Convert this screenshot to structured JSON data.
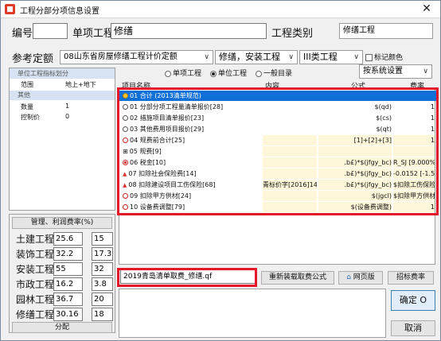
{
  "window": {
    "title": "工程分部分项信息设置",
    "close_glyph": "✕"
  },
  "header": {
    "code_label": "编号",
    "code_value": "",
    "project_label": "单项工程",
    "project_value": "修缮",
    "category_label": "工程类别",
    "category_value": "修缮工程"
  },
  "quota": {
    "label": "参考定额",
    "value": "08山东省房屋修缮工程计价定额",
    "type_value": "修缮，安装工程",
    "class_value": "III类工程",
    "mark_color_label": "标记颜色"
  },
  "radios": [
    {
      "label": "单项工程",
      "selected": false
    },
    {
      "label": "单位工程",
      "selected": true
    },
    {
      "label": "一般目录",
      "selected": false
    }
  ],
  "settings_dropdown": "按系统设置",
  "props": {
    "group1": "单位工程指标划分",
    "scope_label": "范围",
    "scope_value": "地上+地下",
    "group2": "其他",
    "qty_label": "数量",
    "qty_value": "1",
    "ctrl_label": "控制价",
    "ctrl_value": "0"
  },
  "table": {
    "headers": [
      "项目名称",
      "内容",
      "公式",
      "费率"
    ],
    "rows": [
      {
        "name": "01 合计 (2013清单规范)",
        "content": "",
        "formula": "",
        "rate": "",
        "node": "first"
      },
      {
        "name": "01 分部分项工程量清单报价[28]",
        "content": "",
        "formula": "$(qd)",
        "rate": "1",
        "node": "open"
      },
      {
        "name": "02 措施项目清单报价[23]",
        "content": "",
        "formula": "$(cs)",
        "rate": "1",
        "node": "open"
      },
      {
        "name": "03 其他费用项目报价[29]",
        "content": "",
        "formula": "$(qt)",
        "rate": "1",
        "node": "open"
      },
      {
        "name": "04 规费前合计[25]",
        "content": "",
        "formula": "[1]+[2]+[3]",
        "rate": "1",
        "node": "red"
      },
      {
        "name": "05 规费[9]",
        "content": "",
        "formula": "",
        "rate": "",
        "node": "tree"
      },
      {
        "name": "06 税金[10]",
        "content": "",
        "formula": ".b£)*$(jfgy_bc)",
        "rate": "R_SJ [9.000%]",
        "node": "redfill"
      },
      {
        "name": "07 扣除社会保险费[14]",
        "content": "",
        "formula": ".b£)*$(jfgy_bc)",
        "rate": "-0.0152 [-1.520%]",
        "node": "tri"
      },
      {
        "name": "08 扣除建设项目工伤保险[68]",
        "content": "青标价字[2016]14",
        "formula": ".b£)*$(jfgy_bc)",
        "rate": "$扣除工伤保险",
        "node": "tri"
      },
      {
        "name": "09 扣除甲方供材[24]",
        "content": "",
        "formula": "$(jgcl)",
        "rate": "$扣除甲方供材",
        "node": "red"
      },
      {
        "name": "10 设备费调整[79]",
        "content": "",
        "formula": "$(设备费调整)",
        "rate": "1",
        "node": "red"
      }
    ]
  },
  "rates": {
    "title": "管理、利润费率(%)",
    "items": [
      {
        "label": "土建工程",
        "a": "25.6",
        "b": "15"
      },
      {
        "label": "装饰工程",
        "a": "32.2",
        "b": "17.3"
      },
      {
        "label": "安装工程",
        "a": "55",
        "b": "32"
      },
      {
        "label": "市政工程",
        "a": "16.2",
        "b": "3.8"
      },
      {
        "label": "园林工程",
        "a": "36.7",
        "b": "20"
      },
      {
        "label": "修缮工程",
        "a": "30.16",
        "b": "18"
      }
    ],
    "allocate_button": "分配"
  },
  "bottom": {
    "file_value": "2019青岛清单取费_修缮.qf",
    "reload_button": "重新装载取费公式",
    "web_button": "网页版",
    "bid_button": "招标费率",
    "ok_button": "确定 O",
    "cancel_button": "取消"
  }
}
